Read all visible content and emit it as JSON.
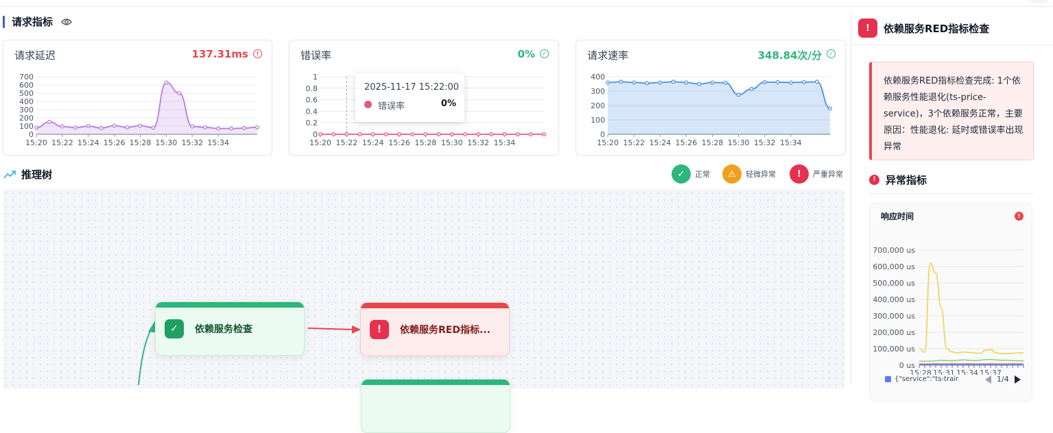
{
  "section": {
    "title": "请求指标"
  },
  "cards": [
    {
      "title": "请求延迟",
      "value": "137.31ms",
      "status": "warning",
      "color": "#e5484d"
    },
    {
      "title": "错误率",
      "value": "0%",
      "status": "ok",
      "color": "#2fb67c"
    },
    {
      "title": "请求速率",
      "value": "348.84次/分",
      "status": "ok",
      "color": "#2fb67c"
    }
  ],
  "tooltip": {
    "time": "2025-11-17 15:22:00",
    "series": "错误率",
    "value": "0%"
  },
  "tree": {
    "title": "推理树"
  },
  "legend": [
    {
      "label": "正常",
      "icon": "check-icon",
      "color": "#2fb67c"
    },
    {
      "label": "轻微异常",
      "icon": "warning-icon",
      "color": "#f0a020"
    },
    {
      "label": "严重异常",
      "icon": "alert-icon",
      "color": "#e5304f"
    }
  ],
  "nodes": [
    {
      "label": "依赖服务检查",
      "status": "normal"
    },
    {
      "label": "依赖服务RED指标...",
      "status": "severe"
    }
  ],
  "panel": {
    "title": "依赖服务RED指标检查",
    "message": "依赖服务RED指标检查完成: 1个依赖服务性能退化(ts-price-service)，3个依赖服务正常，主要原因：性能退化: 延时或错误率出现异常",
    "anomaly_title": "异常指标",
    "mini_chart": {
      "title": "响应时间",
      "legend_text": "{\"service\":\"ts-trair",
      "page": "1/4"
    }
  },
  "chart_data": [
    {
      "type": "area",
      "title": "请求延迟",
      "x": [
        "15:20",
        "15:21",
        "15:22",
        "15:23",
        "15:24",
        "15:25",
        "15:26",
        "15:27",
        "15:28",
        "15:29",
        "15:30",
        "15:31",
        "15:32",
        "15:33",
        "15:34",
        "15:35",
        "15:36",
        "15:37"
      ],
      "x_ticks": [
        "15:20",
        "15:22",
        "15:24",
        "15:26",
        "15:28",
        "15:30",
        "15:32",
        "15:34"
      ],
      "values": [
        80,
        150,
        95,
        80,
        100,
        75,
        105,
        85,
        105,
        80,
        630,
        500,
        95,
        85,
        70,
        70,
        75,
        85
      ],
      "ylim": [
        0,
        700
      ],
      "y_ticks": [
        0,
        100,
        200,
        300,
        400,
        500,
        600,
        700
      ],
      "color": "#b57edc"
    },
    {
      "type": "line",
      "title": "错误率",
      "x": [
        "15:20",
        "15:21",
        "15:22",
        "15:23",
        "15:24",
        "15:25",
        "15:26",
        "15:27",
        "15:28",
        "15:29",
        "15:30",
        "15:31",
        "15:32",
        "15:33",
        "15:34",
        "15:35",
        "15:36",
        "15:37"
      ],
      "x_ticks": [
        "15:20",
        "15:22",
        "15:24",
        "15:26",
        "15:28",
        "15:30",
        "15:32",
        "15:34"
      ],
      "values": [
        0,
        0,
        0,
        0,
        0,
        0,
        0,
        0,
        0,
        0,
        0,
        0,
        0,
        0,
        0,
        0,
        0,
        0
      ],
      "ylim": [
        0,
        1
      ],
      "y_ticks": [
        0,
        0.2,
        0.4,
        0.6,
        0.8,
        1
      ],
      "color": "#e8587a"
    },
    {
      "type": "area",
      "title": "请求速率",
      "x": [
        "15:20",
        "15:21",
        "15:22",
        "15:23",
        "15:24",
        "15:25",
        "15:26",
        "15:27",
        "15:28",
        "15:29",
        "15:30",
        "15:31",
        "15:32",
        "15:33",
        "15:34",
        "15:35",
        "15:36",
        "15:37"
      ],
      "x_ticks": [
        "15:20",
        "15:22",
        "15:24",
        "15:26",
        "15:28",
        "15:30",
        "15:32",
        "15:34"
      ],
      "values": [
        360,
        365,
        360,
        355,
        360,
        365,
        360,
        350,
        360,
        358,
        275,
        315,
        362,
        362,
        360,
        362,
        365,
        180
      ],
      "ylim": [
        0,
        400
      ],
      "y_ticks": [
        0,
        100,
        200,
        300,
        400
      ],
      "color": "#4a90e2"
    },
    {
      "type": "line",
      "title": "响应时间",
      "x_ticks": [
        "15:28",
        "15:31",
        "15:34",
        "15:37"
      ],
      "y_ticks": [
        "0 us",
        "100,000 us",
        "200,000 us",
        "300,000 us",
        "400,000 us",
        "500,000 us",
        "600,000 us",
        "700,000 us"
      ],
      "ylim": [
        0,
        700000
      ],
      "series": [
        {
          "color": "#f0d050",
          "values": [
            100000,
            80000,
            620000,
            560000,
            350000,
            100000,
            80000,
            75000,
            80000,
            78000,
            75000,
            72000,
            90000,
            95000,
            75000,
            70000,
            70000,
            72000,
            75000,
            75000
          ]
        },
        {
          "color": "#7dd87d",
          "values": [
            25000,
            24000,
            25000,
            26000,
            30000,
            28000,
            27000,
            30000,
            32000,
            30000,
            28000,
            30000,
            33000,
            35000,
            32000,
            30000,
            30000,
            28000,
            27000,
            28000
          ]
        },
        {
          "color": "#f08080",
          "values": [
            8000,
            8000,
            8000,
            9000,
            8000,
            8000,
            9000,
            8000,
            8000,
            9000,
            8000,
            8000,
            8000,
            9000,
            8000,
            8000,
            8000,
            9000,
            8000,
            8000
          ]
        },
        {
          "color": "#5b7cf0",
          "values": [
            3000,
            3000,
            3000,
            3000,
            3000,
            3000,
            3000,
            3000,
            3000,
            3000,
            3000,
            3000,
            3000,
            3000,
            3000,
            3000,
            3000,
            3000,
            3000,
            3000
          ]
        }
      ]
    }
  ]
}
